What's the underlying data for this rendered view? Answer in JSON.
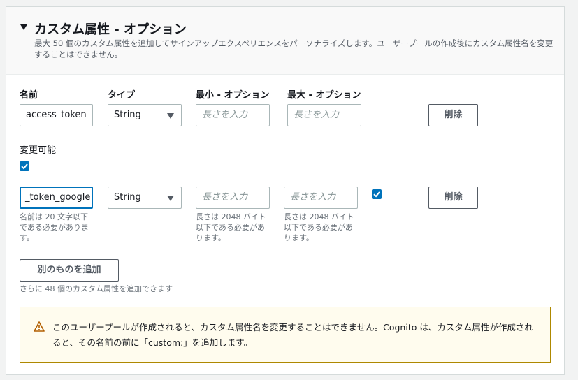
{
  "section": {
    "title": "カスタム属性 - オプション",
    "description": "最大 50 個のカスタム属性を追加してサインアップエクスペリエンスをパーソナライズします。ユーザープールの作成後にカスタム属性名を変更することはできません。"
  },
  "columns": {
    "name": "名前",
    "type": "タイプ",
    "min": "最小 - オプション",
    "max": "最大 - オプション"
  },
  "rows": [
    {
      "name_value": "access_token_",
      "type_value": "String",
      "min_placeholder": "長さを入力",
      "max_placeholder": "長さを入力",
      "delete_label": "削除",
      "mutable_label": "変更可能",
      "mutable_checked": true
    },
    {
      "name_value": "_token_google",
      "type_value": "String",
      "min_placeholder": "長さを入力",
      "max_placeholder": "長さを入力",
      "delete_label": "削除",
      "mutable_checked": true,
      "name_hint": "名前は 20 文字以下である必要があります。",
      "min_hint": "長さは 2048 バイト以下である必要があります。",
      "max_hint": "長さは 2048 バイト以下である必要があります。"
    }
  ],
  "add_button": "別のものを追加",
  "remaining_text": "さらに 48 個のカスタム属性を追加できます",
  "alert": {
    "icon": "warning-icon",
    "text": "このユーザープールが作成されると、カスタム属性名を変更することはできません。Cognito は、カスタム属性が作成されると、その名前の前に「custom:」を追加します。",
    "border_color": "#ae8800",
    "background_color": "#fffcee"
  },
  "colors": {
    "accent": "#0073bb"
  }
}
